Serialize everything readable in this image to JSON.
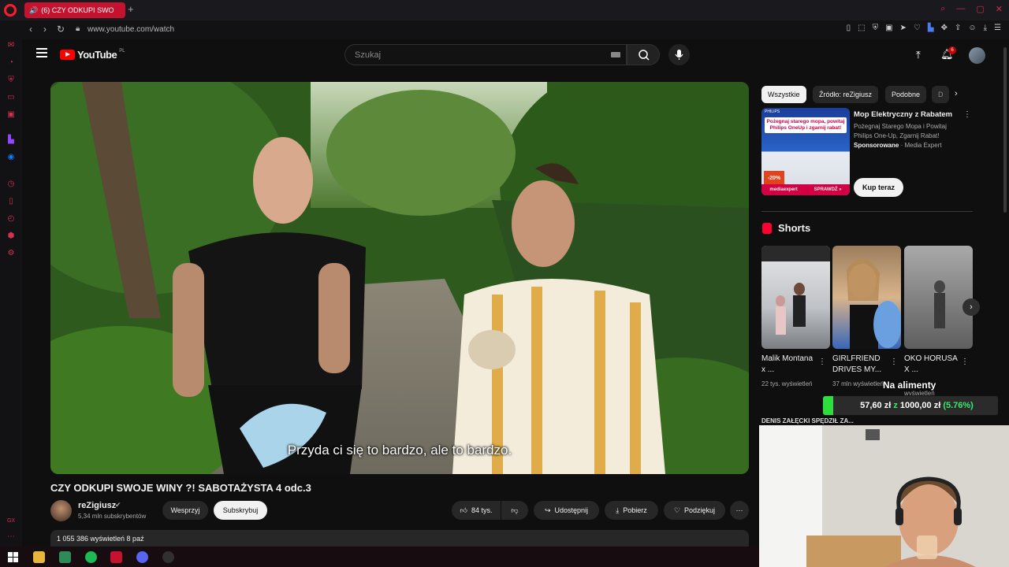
{
  "browser": {
    "tab_title": "(6) CZY ODKUPI SWO",
    "tab_audio_icon": "speaker-icon",
    "new_tab": "+",
    "url": "www.youtube.com/watch",
    "window_controls": [
      "search-icon",
      "minimize-icon",
      "maximize-icon",
      "close-icon"
    ]
  },
  "youtube": {
    "logo_text": "YouTube",
    "logo_country": "PL",
    "search_placeholder": "Szukaj",
    "notification_count": "6"
  },
  "video": {
    "subtitle": "Przyda ci się to bardzo, ale to bardzo.",
    "title": "CZY ODKUPI SWOJE WINY ?! SABOTAŻYSTA 4 odc.3",
    "channel_name": "reZigiusz",
    "channel_subs": "5,34 mln subskrybentów",
    "support_label": "Wesprzyj",
    "subscribe_label": "Subskrybuj",
    "likes": "84 tys.",
    "share_label": "Udostępnij",
    "download_label": "Pobierz",
    "thanks_label": "Podziękuj",
    "views_date": "1 055 386 wyświetleń  8 paź"
  },
  "sidebar_feed": {
    "chips": [
      "Wszystkie",
      "Źródło: reZigiusz",
      "Podobne",
      "D"
    ],
    "ad": {
      "title": "Mop Elektryczny z Rabatem",
      "description": "Pożegnaj Starego Mopa i Powitaj Philips One-Up, Zgarnij Rabat!",
      "sponsored": "Sponsorowane",
      "advertiser": "Media Expert",
      "cta": "Kup teraz",
      "banner_text": "Pożegnaj starego mopa, powitaj Philips OneUp i zgarnij rabat!",
      "promo": "-20%",
      "footer_brand": "mediaexpert",
      "footer_cta": "SPRAWDŹ »",
      "brand_tag": "PHILIPS"
    },
    "shorts_heading": "Shorts",
    "shorts": [
      {
        "title": "Malik Montana x ...",
        "views": "22 tys. wyświetleń"
      },
      {
        "title": "GIRLFRIEND DRIVES MY...",
        "views": "37 mln wyświetleń"
      },
      {
        "title": "OKO HORUSA X ...",
        "views": "wyświetleń"
      }
    ],
    "next_item": "DENIS ZAŁĘCKI SPĘDZIŁ ZA..."
  },
  "overlay": {
    "donation_title": "Na alimenty",
    "donation_current": "57,60 zł",
    "donation_sep": "z",
    "donation_goal": "1000,00 zł",
    "donation_pct": "(5.76%)",
    "donation_fraction": 0.0576
  },
  "colors": {
    "youtube_red": "#ff0000",
    "opera_red": "#c4122f",
    "donation_green": "#2ede3c"
  }
}
